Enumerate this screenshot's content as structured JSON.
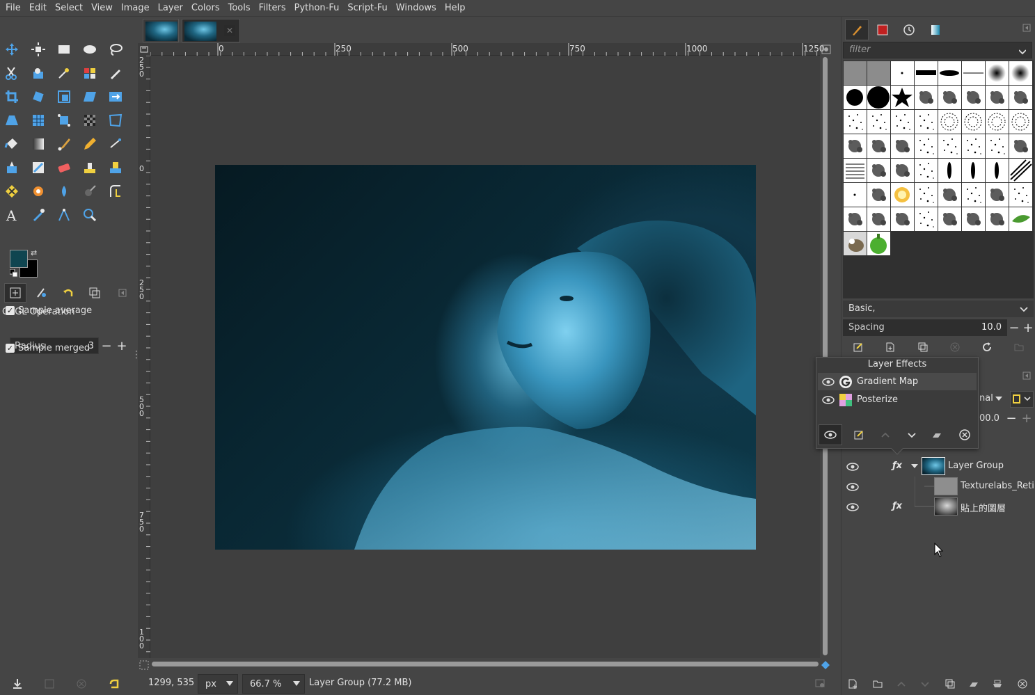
{
  "menubar": [
    "File",
    "Edit",
    "Select",
    "View",
    "Image",
    "Layer",
    "Colors",
    "Tools",
    "Filters",
    "Python-Fu",
    "Script-Fu",
    "Windows",
    "Help"
  ],
  "colors": {
    "foreground": "#0f4550",
    "background": "#000000",
    "accent": "#3d8fd8"
  },
  "tool_options": {
    "title": "GEGL Operation",
    "sample_average_label": "Sample average",
    "radius_label": "Radius",
    "radius_value": "3",
    "sample_merged_label": "Sample merged"
  },
  "rulers": {
    "top": [
      "0",
      "250",
      "500",
      "750",
      "1000",
      "1250"
    ],
    "left": [
      "250",
      "0",
      "250",
      "500",
      "750",
      "100"
    ]
  },
  "statusbar": {
    "coords": "1299, 535",
    "unit": "px",
    "zoom": "66.7 %",
    "message": "Layer Group (77.2 MB)"
  },
  "brushes": {
    "filter_placeholder": "filter",
    "preset": "Basic,",
    "spacing_label": "Spacing",
    "spacing_value": "10.0"
  },
  "layer_effects": {
    "title": "Layer Effects",
    "items": [
      {
        "name": "Gradient Map"
      },
      {
        "name": "Posterize"
      }
    ]
  },
  "layers_partial": {
    "mode_fragment": "nal",
    "opacity_fragment": "00.0"
  },
  "layers": [
    {
      "name": "Layer Group",
      "has_fx": true
    },
    {
      "name": "Texturelabs_Reticu",
      "has_fx": false
    },
    {
      "name": "貼上的圖層",
      "has_fx": true
    }
  ]
}
